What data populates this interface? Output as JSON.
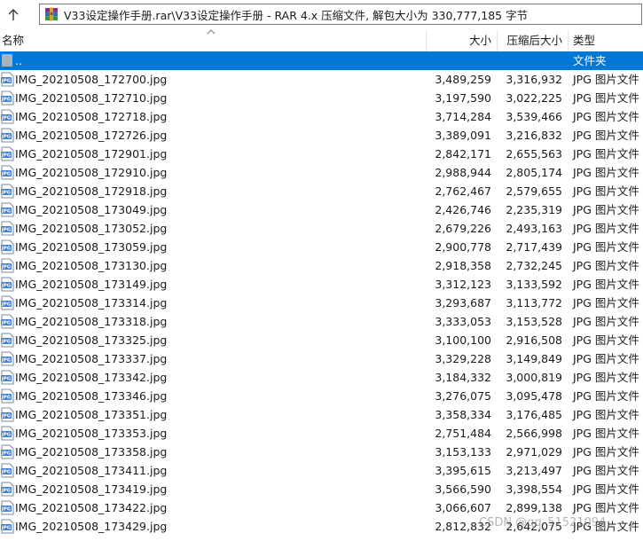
{
  "address": {
    "path": "V33设定操作手册.rar\\V33设定操作手册 - RAR 4.x 压缩文件, 解包大小为 330,777,185 字节"
  },
  "columns": {
    "name": "名称",
    "size": "大小",
    "packed": "压缩后大小",
    "type": "类型"
  },
  "parent_row": {
    "name": "..",
    "type": "文件夹"
  },
  "files": [
    {
      "name": "IMG_20210508_172700.jpg",
      "size": "3,489,259",
      "packed": "3,316,932",
      "type": "JPG 图片文件"
    },
    {
      "name": "IMG_20210508_172710.jpg",
      "size": "3,197,590",
      "packed": "3,022,225",
      "type": "JPG 图片文件"
    },
    {
      "name": "IMG_20210508_172718.jpg",
      "size": "3,714,284",
      "packed": "3,539,466",
      "type": "JPG 图片文件"
    },
    {
      "name": "IMG_20210508_172726.jpg",
      "size": "3,389,091",
      "packed": "3,216,832",
      "type": "JPG 图片文件"
    },
    {
      "name": "IMG_20210508_172901.jpg",
      "size": "2,842,171",
      "packed": "2,655,563",
      "type": "JPG 图片文件"
    },
    {
      "name": "IMG_20210508_172910.jpg",
      "size": "2,988,944",
      "packed": "2,805,174",
      "type": "JPG 图片文件"
    },
    {
      "name": "IMG_20210508_172918.jpg",
      "size": "2,762,467",
      "packed": "2,579,655",
      "type": "JPG 图片文件"
    },
    {
      "name": "IMG_20210508_173049.jpg",
      "size": "2,426,746",
      "packed": "2,235,319",
      "type": "JPG 图片文件"
    },
    {
      "name": "IMG_20210508_173052.jpg",
      "size": "2,679,226",
      "packed": "2,493,163",
      "type": "JPG 图片文件"
    },
    {
      "name": "IMG_20210508_173059.jpg",
      "size": "2,900,778",
      "packed": "2,717,439",
      "type": "JPG 图片文件"
    },
    {
      "name": "IMG_20210508_173130.jpg",
      "size": "2,918,358",
      "packed": "2,732,245",
      "type": "JPG 图片文件"
    },
    {
      "name": "IMG_20210508_173149.jpg",
      "size": "3,312,123",
      "packed": "3,133,592",
      "type": "JPG 图片文件"
    },
    {
      "name": "IMG_20210508_173314.jpg",
      "size": "3,293,687",
      "packed": "3,113,772",
      "type": "JPG 图片文件"
    },
    {
      "name": "IMG_20210508_173318.jpg",
      "size": "3,333,053",
      "packed": "3,153,528",
      "type": "JPG 图片文件"
    },
    {
      "name": "IMG_20210508_173325.jpg",
      "size": "3,100,100",
      "packed": "2,916,508",
      "type": "JPG 图片文件"
    },
    {
      "name": "IMG_20210508_173337.jpg",
      "size": "3,329,228",
      "packed": "3,149,849",
      "type": "JPG 图片文件"
    },
    {
      "name": "IMG_20210508_173342.jpg",
      "size": "3,184,332",
      "packed": "3,000,819",
      "type": "JPG 图片文件"
    },
    {
      "name": "IMG_20210508_173346.jpg",
      "size": "3,276,075",
      "packed": "3,095,478",
      "type": "JPG 图片文件"
    },
    {
      "name": "IMG_20210508_173351.jpg",
      "size": "3,358,334",
      "packed": "3,176,485",
      "type": "JPG 图片文件"
    },
    {
      "name": "IMG_20210508_173353.jpg",
      "size": "2,751,484",
      "packed": "2,566,998",
      "type": "JPG 图片文件"
    },
    {
      "name": "IMG_20210508_173358.jpg",
      "size": "3,153,133",
      "packed": "2,971,029",
      "type": "JPG 图片文件"
    },
    {
      "name": "IMG_20210508_173411.jpg",
      "size": "3,395,615",
      "packed": "3,213,497",
      "type": "JPG 图片文件"
    },
    {
      "name": "IMG_20210508_173419.jpg",
      "size": "3,566,590",
      "packed": "3,398,554",
      "type": "JPG 图片文件"
    },
    {
      "name": "IMG_20210508_173422.jpg",
      "size": "3,066,607",
      "packed": "2,899,138",
      "type": "JPG 图片文件"
    },
    {
      "name": "IMG_20210508_173429.jpg",
      "size": "2,812,832",
      "packed": "2,642,075",
      "type": "JPG 图片文件"
    }
  ],
  "watermark": "CSDN @qq_51521094",
  "colors": {
    "selection": "#0078d7",
    "icon_blue": "#3b7dd8"
  }
}
